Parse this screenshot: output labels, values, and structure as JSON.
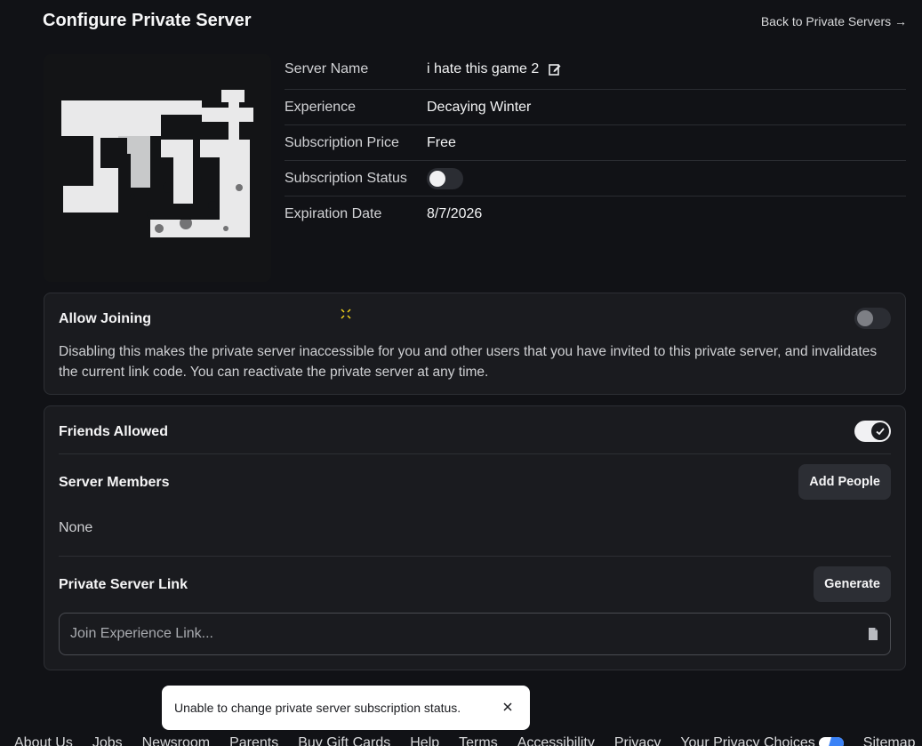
{
  "header": {
    "title": "Configure Private Server",
    "back_link": "Back to Private Servers →"
  },
  "details": {
    "server_name_label": "Server Name",
    "server_name_value": "i hate this game 2",
    "experience_label": "Experience",
    "experience_value": "Decaying Winter",
    "price_label": "Subscription Price",
    "price_value": "Free",
    "status_label": "Subscription Status",
    "status_on": false,
    "expiration_label": "Expiration Date",
    "expiration_value": "8/7/2026"
  },
  "allow_joining": {
    "title": "Allow Joining",
    "enabled": false,
    "description": "Disabling this makes the private server inaccessible for you and other users that you have invited to this private server, and invalidates the current link code. You can reactivate the private server at any time."
  },
  "friends": {
    "title": "Friends Allowed",
    "enabled": true,
    "members_title": "Server Members",
    "add_people_label": "Add People",
    "members_empty": "None",
    "link_title": "Private Server Link",
    "generate_label": "Generate",
    "link_placeholder": "Join Experience Link..."
  },
  "toast": {
    "message": "Unable to change private server subscription status."
  },
  "footer": {
    "links": [
      "About Us",
      "Jobs",
      "Newsroom",
      "Parents",
      "Buy Gift Cards",
      "Help",
      "Terms",
      "Accessibility",
      "Privacy",
      "Your Privacy Choices",
      "Sitemap"
    ]
  },
  "colors": {
    "background": "#111216",
    "card": "#1a1b1f",
    "accent_privacy": "#3b82f6"
  },
  "icons": [
    "edit-icon",
    "copy-icon",
    "close-icon",
    "checkmark-icon",
    "privacy-choices-icon"
  ]
}
